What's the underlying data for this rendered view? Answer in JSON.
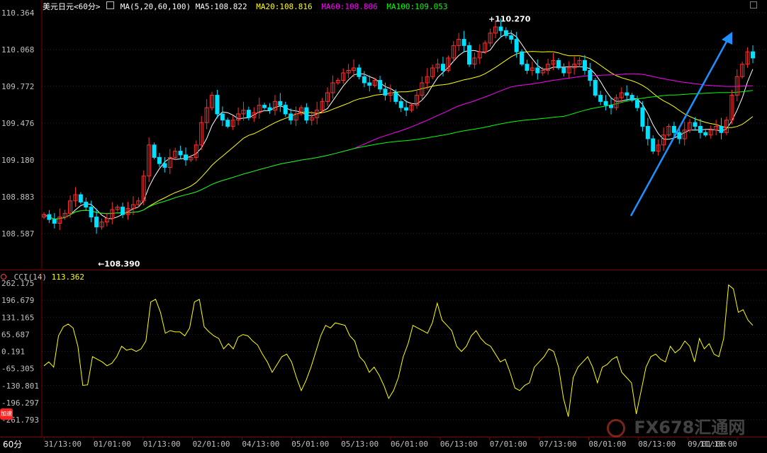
{
  "header": {
    "title": "美元日元<60分>",
    "ma_label": "MA(5,20,60,100)",
    "ma5": "MA5:108.822",
    "ma20": "MA20:108.816",
    "ma60": "MA60:108.806",
    "ma100": "MA100:109.053"
  },
  "cci_header": {
    "label": "CCI(14)",
    "value": "113.362"
  },
  "period_button": "60分",
  "badge_text": "加速",
  "watermark": "FX678汇通网",
  "colors": {
    "up": "#ff3030",
    "down": "#00e0ff",
    "ma5": "#ffffff",
    "ma20": "#ffff00",
    "ma60": "#ff00ff",
    "ma100": "#00ff00",
    "cci": "#ffff00",
    "arrow": "#1e90ff",
    "grid": "#800000",
    "axis_text": "#c0c0c0"
  },
  "chart_data": [
    {
      "type": "candlestick",
      "title": "美元日元<60分>",
      "y_ticks": [
        "110.364",
        "110.068",
        "109.772",
        "109.476",
        "109.180",
        "108.883",
        "108.587"
      ],
      "ylim": [
        108.4,
        110.4
      ],
      "x_ticks": [
        "31/13:00",
        "01/01:00",
        "01/13:00",
        "02/01:00",
        "04/13:00",
        "05/01:00",
        "05/13:00",
        "06/01:00",
        "06/13:00",
        "07/01:00",
        "07/13:00",
        "08/01:00",
        "08/13:00",
        "09/01:00",
        "11/13:00"
      ],
      "annotations": [
        {
          "text": "+110.270",
          "value": 110.27,
          "kind": "high"
        },
        {
          "text": "←108.390",
          "value": 108.39,
          "kind": "low"
        }
      ],
      "series": [
        {
          "name": "MA5",
          "values": []
        },
        {
          "name": "MA20",
          "values": []
        },
        {
          "name": "MA60",
          "values": []
        },
        {
          "name": "MA100",
          "values": []
        }
      ],
      "close": [
        108.74,
        108.7,
        108.67,
        108.72,
        108.75,
        108.85,
        108.9,
        108.84,
        108.8,
        108.72,
        108.64,
        108.68,
        108.71,
        108.78,
        108.8,
        108.74,
        108.79,
        108.82,
        108.85,
        109.05,
        109.3,
        109.2,
        109.15,
        109.12,
        109.2,
        109.25,
        109.22,
        109.18,
        109.2,
        109.3,
        109.48,
        109.6,
        109.7,
        109.55,
        109.5,
        109.45,
        109.5,
        109.55,
        109.58,
        109.52,
        109.56,
        109.62,
        109.6,
        109.58,
        109.65,
        109.62,
        109.55,
        109.5,
        109.55,
        109.6,
        109.5,
        109.52,
        109.58,
        109.65,
        109.72,
        109.8,
        109.82,
        109.88,
        109.9,
        109.92,
        109.85,
        109.8,
        109.78,
        109.82,
        109.75,
        109.7,
        109.72,
        109.65,
        109.6,
        109.58,
        109.62,
        109.7,
        109.8,
        109.85,
        109.92,
        109.95,
        109.9,
        110.0,
        110.1,
        110.15,
        110.1,
        109.95,
        110.0,
        110.05,
        110.12,
        110.2,
        110.25,
        110.22,
        110.18,
        110.15,
        110.05,
        109.95,
        109.9,
        109.92,
        109.88,
        109.9,
        109.95,
        109.98,
        109.92,
        109.88,
        109.92,
        109.95,
        109.98,
        109.9,
        109.82,
        109.7,
        109.65,
        109.62,
        109.6,
        109.68,
        109.72,
        109.7,
        109.66,
        109.6,
        109.45,
        109.35,
        109.25,
        109.3,
        109.38,
        109.45,
        109.4,
        109.35,
        109.42,
        109.48,
        109.45,
        109.4,
        109.38,
        109.42,
        109.45,
        109.4,
        109.5,
        109.7,
        109.85,
        109.95,
        110.05,
        110.0
      ],
      "x": [],
      "cci": {
        "name": "CCI(14)",
        "y_ticks": [
          "262.175",
          "196.679",
          "131.165",
          "65.687",
          "0.191",
          "-65.305",
          "-130.801",
          "-196.297",
          "-261.793"
        ],
        "ylim": [
          -262,
          262
        ],
        "values": [
          -55,
          -40,
          -60,
          60,
          95,
          105,
          90,
          20,
          -130,
          -128,
          -20,
          -30,
          -40,
          -55,
          -45,
          -20,
          20,
          5,
          10,
          0,
          10,
          40,
          190,
          200,
          150,
          70,
          80,
          75,
          75,
          60,
          90,
          190,
          200,
          95,
          75,
          60,
          50,
          10,
          30,
          10,
          55,
          65,
          60,
          40,
          25,
          -10,
          -40,
          -80,
          -50,
          -20,
          -10,
          -40,
          -100,
          -150,
          -110,
          -60,
          0,
          60,
          100,
          90,
          110,
          105,
          100,
          60,
          40,
          -20,
          -40,
          -80,
          -60,
          -90,
          -130,
          -180,
          -150,
          -100,
          -20,
          30,
          100,
          90,
          80,
          70,
          110,
          185,
          120,
          100,
          80,
          20,
          0,
          20,
          60,
          80,
          50,
          30,
          20,
          -10,
          -40,
          -30,
          -80,
          -140,
          -150,
          -130,
          -120,
          -60,
          -40,
          -20,
          10,
          0,
          -60,
          -180,
          -250,
          -100,
          -60,
          -40,
          -20,
          -60,
          -120,
          -60,
          -50,
          -30,
          -20,
          -80,
          -100,
          -120,
          -240,
          -150,
          -60,
          -20,
          -10,
          -30,
          -40,
          20,
          -5,
          10,
          40,
          20,
          -40,
          50,
          10,
          30,
          -10,
          -20,
          50,
          255,
          240,
          150,
          160,
          120,
          100
        ]
      }
    }
  ]
}
